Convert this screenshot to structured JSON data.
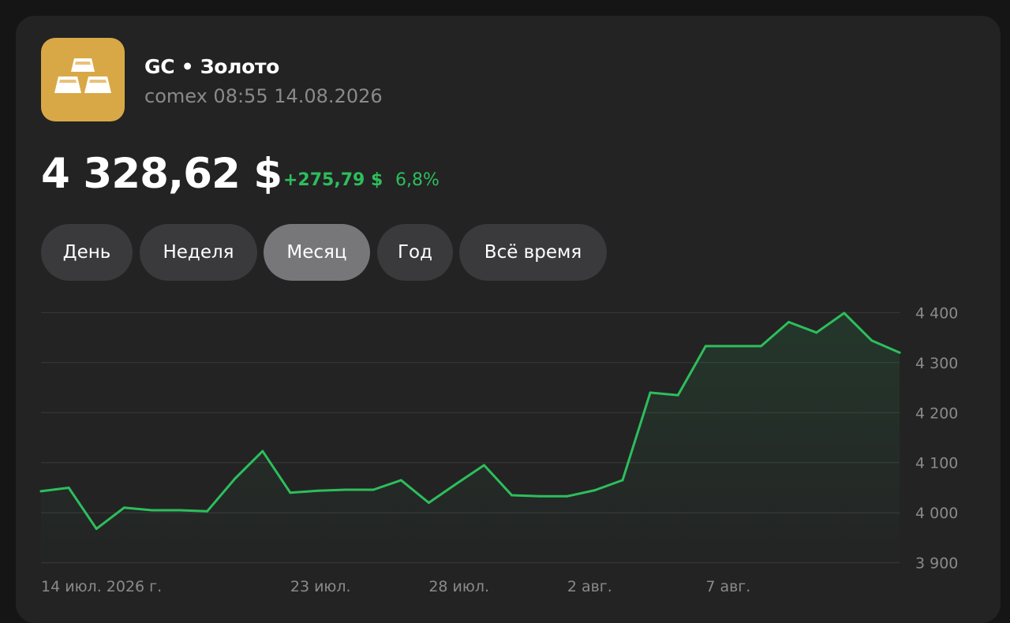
{
  "asset": {
    "title": "GC • Золото",
    "subtitle": "comex 08:55 14.08.2026",
    "price": "4 328,62 $",
    "change": "+275,79 $",
    "change_pct": "6,8%",
    "icon": "gold-bars-icon"
  },
  "tabs": [
    {
      "label": "День",
      "active": false
    },
    {
      "label": "Неделя",
      "active": false
    },
    {
      "label": "Месяц",
      "active": true
    },
    {
      "label": "Год",
      "active": false
    },
    {
      "label": "Всё время",
      "active": false
    }
  ],
  "colors": {
    "background": "#151516",
    "card": "#232324",
    "accent_green": "#2dbe5c",
    "logo": "#d9a846",
    "tab": "#3a3a3c",
    "tab_active": "#777779"
  },
  "chart_data": {
    "type": "area",
    "x": [
      "2026-07-14",
      "2026-07-15",
      "2026-07-16",
      "2026-07-17",
      "2026-07-18",
      "2026-07-19",
      "2026-07-20",
      "2026-07-21",
      "2026-07-22",
      "2026-07-23",
      "2026-07-24",
      "2026-07-25",
      "2026-07-26",
      "2026-07-27",
      "2026-07-28",
      "2026-07-29",
      "2026-07-30",
      "2026-07-31",
      "2026-08-01",
      "2026-08-02",
      "2026-08-03",
      "2026-08-04",
      "2026-08-05",
      "2026-08-06",
      "2026-08-07",
      "2026-08-08",
      "2026-08-09",
      "2026-08-10",
      "2026-08-11",
      "2026-08-12",
      "2026-08-13",
      "2026-08-14"
    ],
    "series": [
      {
        "values": [
          4043,
          4050,
          3968,
          4010,
          4005,
          4005,
          4003,
          4068,
          4123,
          4040,
          4044,
          4046,
          4046,
          4065,
          4020,
          4058,
          4095,
          4035,
          4033,
          4033,
          4045,
          4065,
          4240,
          4235,
          4333,
          4333,
          4333,
          4381,
          4360,
          4399,
          4344,
          4320
        ]
      }
    ],
    "xticks": [
      {
        "x": "2026-07-14",
        "label": "14 июл. 2026 г."
      },
      {
        "x": "2026-07-23",
        "label": "23 июл."
      },
      {
        "x": "2026-07-28",
        "label": "28 июл."
      },
      {
        "x": "2026-08-02",
        "label": "2 авг."
      },
      {
        "x": "2026-08-07",
        "label": "7 авг."
      }
    ],
    "yticks": [
      {
        "value": 4400,
        "label": "4 400"
      },
      {
        "value": 4300,
        "label": "4 300"
      },
      {
        "value": 4200,
        "label": "4 200"
      },
      {
        "value": 4100,
        "label": "4 100"
      },
      {
        "value": 4000,
        "label": "4 000"
      },
      {
        "value": 3900,
        "label": "3 900"
      }
    ],
    "ylim": [
      3890,
      4410
    ],
    "grid": true,
    "line_color": "#2dbe5c"
  }
}
